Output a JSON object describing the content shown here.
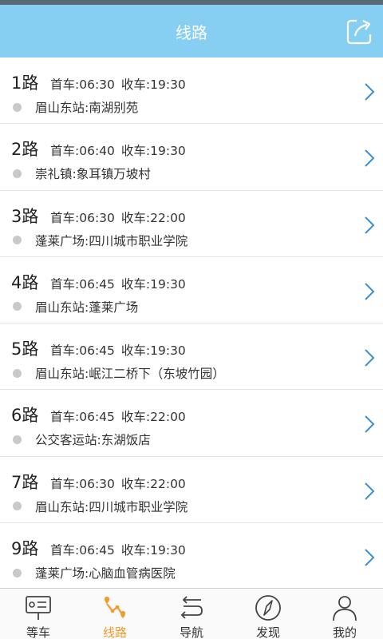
{
  "header": {
    "title": "线路",
    "share_icon": "share-icon"
  },
  "routes": [
    {
      "name": "1路",
      "first": "首车:06:30",
      "last": "收车:19:30",
      "stops": "眉山东站:南湖别苑"
    },
    {
      "name": "2路",
      "first": "首车:06:40",
      "last": "收车:19:30",
      "stops": "崇礼镇:象耳镇万坡村"
    },
    {
      "name": "3路",
      "first": "首车:06:30",
      "last": "收车:22:00",
      "stops": "蓬莱广场:四川城市职业学院"
    },
    {
      "name": "4路",
      "first": "首车:06:45",
      "last": "收车:19:30",
      "stops": "眉山东站:蓬莱广场"
    },
    {
      "name": "5路",
      "first": "首车:06:45",
      "last": "收车:19:30",
      "stops": "眉山东站:岷江二桥下（东坡竹园）"
    },
    {
      "name": "6路",
      "first": "首车:06:45",
      "last": "收车:22:00",
      "stops": "公交客运站:东湖饭店"
    },
    {
      "name": "7路",
      "first": "首车:06:30",
      "last": "收车:22:00",
      "stops": "眉山东站:四川城市职业学院"
    },
    {
      "name": "9路",
      "first": "首车:06:45",
      "last": "收车:19:30",
      "stops": "蓬莱广场:心脑血管病医院"
    }
  ],
  "tabs": [
    {
      "label": "等车",
      "icon": "bus-stop-icon",
      "active": false
    },
    {
      "label": "线路",
      "icon": "route-icon",
      "active": true
    },
    {
      "label": "导航",
      "icon": "navigation-icon",
      "active": false
    },
    {
      "label": "发现",
      "icon": "compass-icon",
      "active": false
    },
    {
      "label": "我的",
      "icon": "profile-icon",
      "active": false
    }
  ],
  "colors": {
    "header": "#86cef2",
    "accent": "#f39a2b",
    "chevron": "#3a8fd6"
  }
}
